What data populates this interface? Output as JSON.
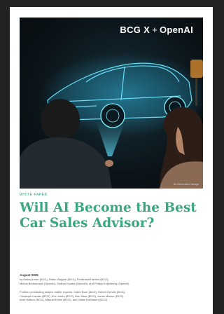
{
  "header": {
    "logo_left": "BCG X",
    "logo_sep": "+",
    "logo_right": "OpenAI"
  },
  "hero": {
    "caption": "AI-Generated Image"
  },
  "doc": {
    "label": "WHITE PAPER",
    "title": "Will AI Become the Best Car Sales Advisor?",
    "date": "August 2025",
    "authors_line1": "by Andrej Levin (BCG), Robin Wagner (BCG), Ferdinand Harries (BCG),",
    "authors_line2": "Michal Bednarczyk (OpenAI), Sridhar Kwatra (OpenAI), and Philipp Eckenberg (OpenAI)",
    "contrib_line1": "Further contributing subject matter experts: Julien Born (BCG), Robert Dendis (BCG),",
    "contrib_line2": "Christoph Hauser (BCG), Eric Jones (BCG), Dan Sack (BCG), Jonas Milzner (BCG),",
    "contrib_line3": "Amir Hafson (BCG), Manuel Ehrlin (BCG), and Julian Hoßbauer (BCG)"
  },
  "colors": {
    "accent": "#3aa77e",
    "hologram": "#3ad6ff"
  }
}
